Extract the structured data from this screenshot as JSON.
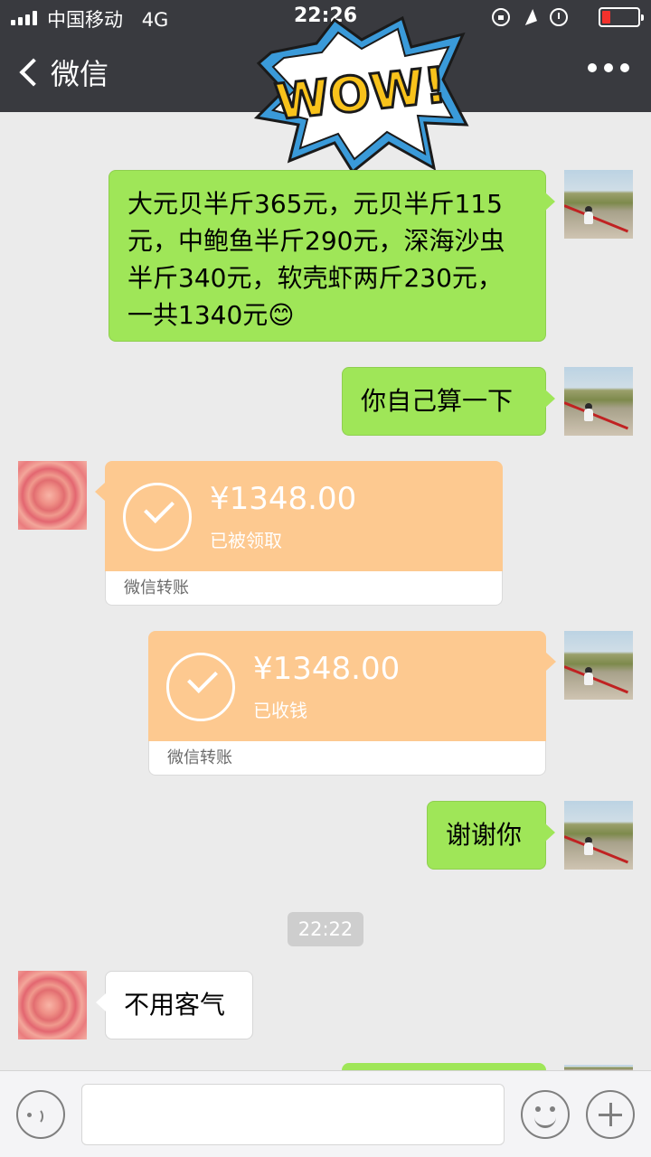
{
  "status_bar": {
    "carrier": "中国移动",
    "network": "4G",
    "time": "22:26",
    "battery_color": "#f3312c"
  },
  "nav": {
    "back_label": "微信"
  },
  "sticker": {
    "text": "WOW!"
  },
  "messages": {
    "m1": "大元贝半斤365元，元贝半斤115元，中鲍鱼半斤290元，深海沙虫半斤340元，软壳虾两斤230元，一共1340元",
    "m1_emoji": "😊",
    "m2": "你自己算一下",
    "t1": {
      "amount": "¥1348.00",
      "status": "已被领取",
      "footer": "微信转账"
    },
    "t2": {
      "amount": "¥1348.00",
      "status": "已收钱",
      "footer": "微信转账"
    },
    "m3": "谢谢你",
    "timestamp": "22:22",
    "m4": "不用客气"
  },
  "colors": {
    "green_bubble": "#9fe658",
    "transfer_orange": "#fdc990",
    "nav_bg": "#393a3f",
    "chat_bg": "#ebebeb"
  },
  "input": {
    "placeholder": ""
  }
}
